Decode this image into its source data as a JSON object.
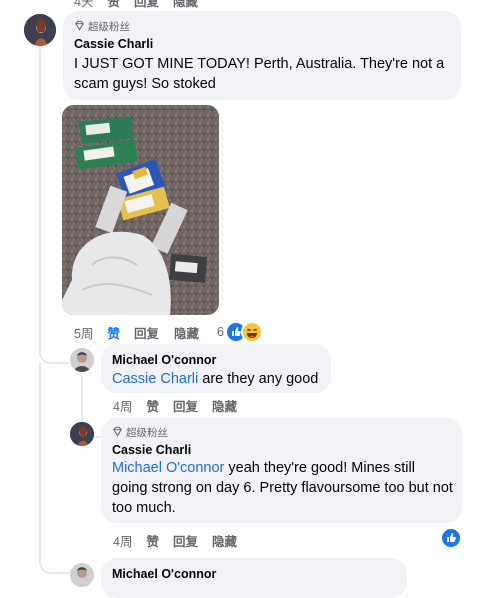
{
  "top_row": {
    "time": "4天",
    "like": "赞",
    "reply": "回复",
    "hide": "隐藏"
  },
  "comment1": {
    "badge": "超级粉丝",
    "author": "Cassie Charli",
    "text": "I JUST GOT MINE TODAY! Perth, Australia. They're not a scam guys! So stoked",
    "time": "5周",
    "like": "赞",
    "reply": "回复",
    "hide": "隐藏",
    "reaction_count": "6",
    "reaction_icons": [
      "like-icon",
      "haha-icon"
    ]
  },
  "reply1": {
    "author": "Michael O'connor",
    "mention": "Cassie Charli",
    "text": " are they any good",
    "time": "4周",
    "like": "赞",
    "reply": "回复",
    "hide": "隐藏"
  },
  "reply2": {
    "badge": "超级粉丝",
    "author": "Cassie Charli",
    "mention": "Michael O'connor",
    "text": " yeah they're good! Mines still going strong on day 6. Pretty flavoursome too but not too much.",
    "time": "4周",
    "like": "赞",
    "reply": "回复",
    "hide": "隐藏",
    "reaction_icons": [
      "like-icon"
    ]
  },
  "reply3": {
    "author": "Michael O'connor"
  },
  "colors": {
    "link": "#216fdb",
    "like_blue": "#1877f2",
    "bubble": "#f0f2f5",
    "meta": "#65676b"
  }
}
